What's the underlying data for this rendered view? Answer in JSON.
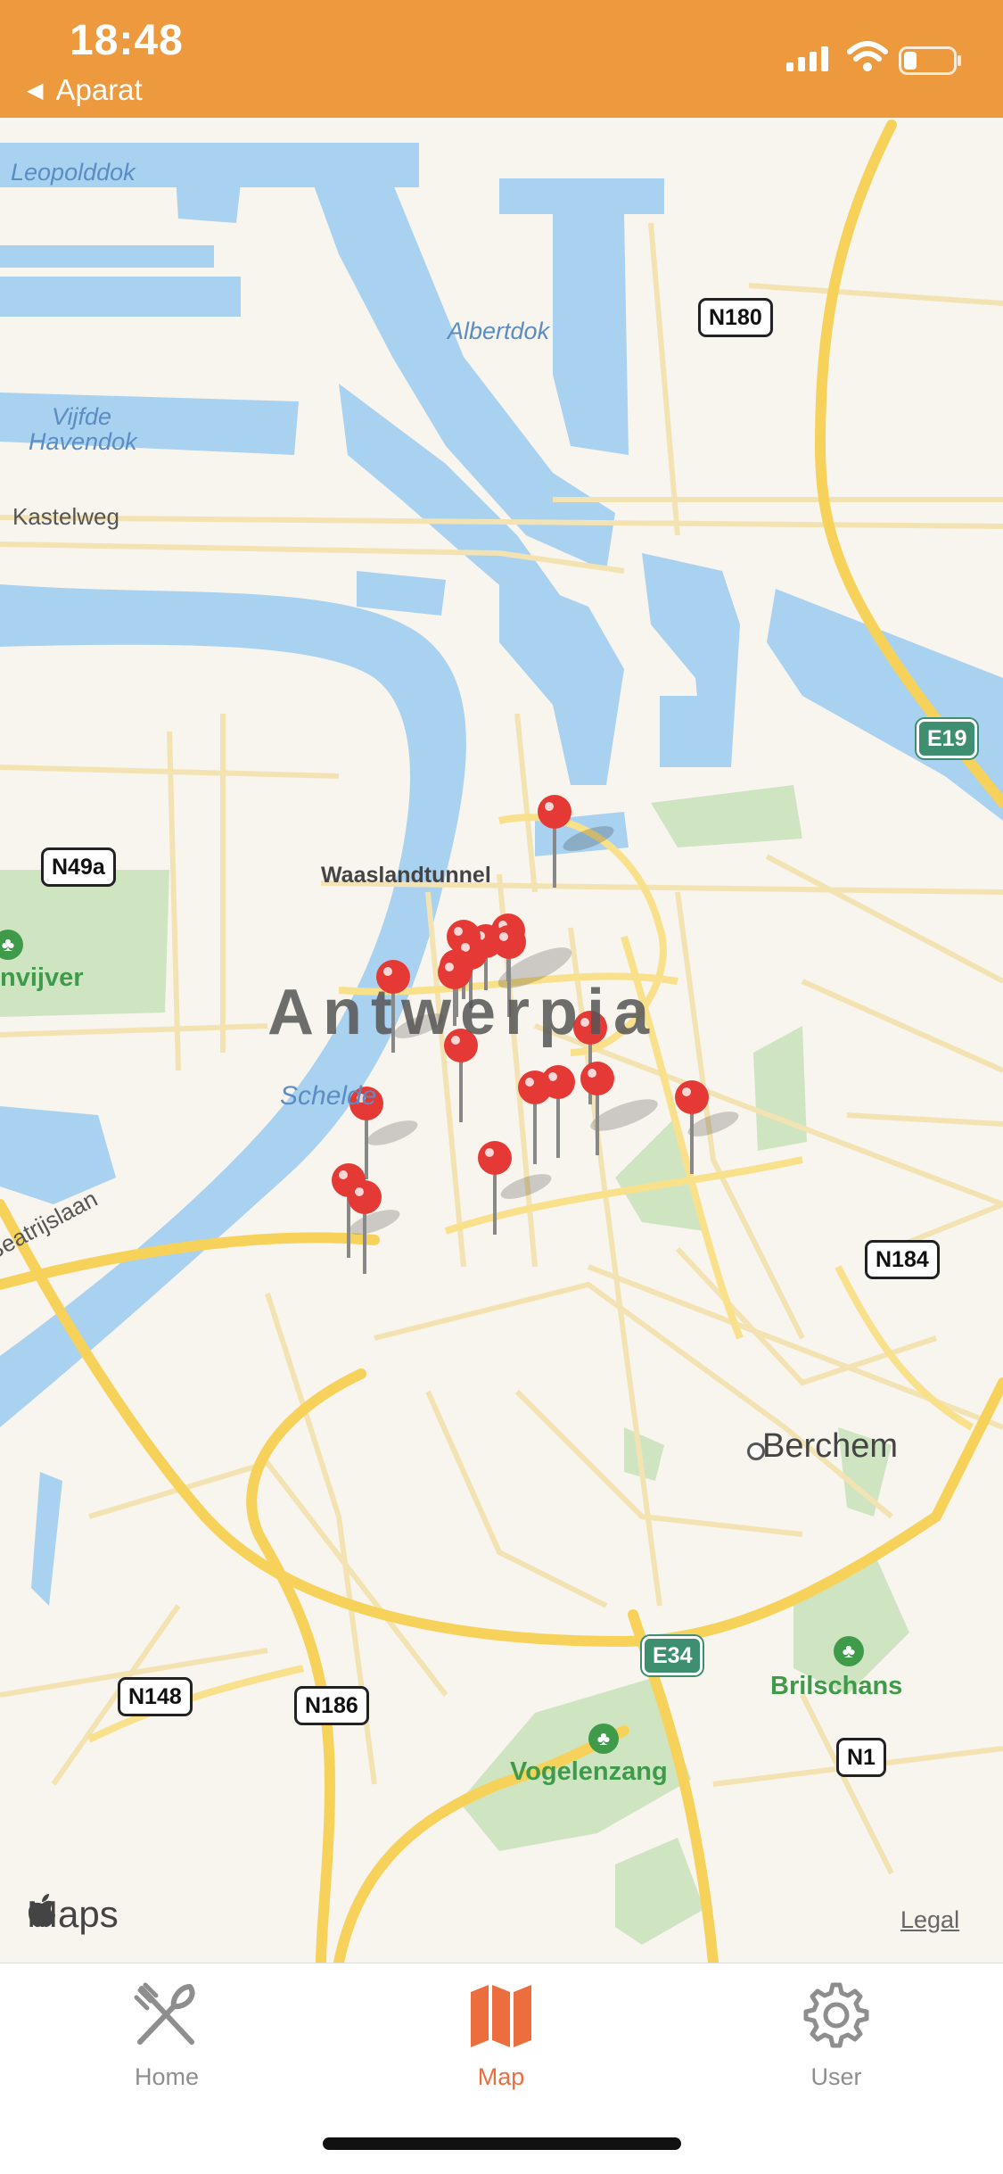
{
  "status_bar": {
    "time": "18:48",
    "back_label": "Aparat"
  },
  "map": {
    "labels": {
      "leopolddok": "Leopolddok",
      "albertdok": "Albertdok",
      "vijfde": "Vijfde",
      "havendok": "Havendok",
      "kastelweg": "Kastelweg",
      "waaslandtunnel": "Waaslandtunnel",
      "city": "Antwerpia",
      "schelde": "Schelde",
      "beatrijslaan": "Beatrijslaan",
      "vijver": "nvijver",
      "berchem": "Berchem",
      "brilschans": "Brilschans",
      "vogelenzang": "Vogelenzang"
    },
    "road_shields": {
      "n180": "N180",
      "e19": "E19",
      "n49a": "N49a",
      "n184": "N184",
      "e34": "E34",
      "n148": "N148",
      "n186": "N186",
      "n1": "N1"
    },
    "pin_count": 19,
    "attribution": {
      "logo": "Maps",
      "legal": "Legal"
    }
  },
  "tab_bar": {
    "home": "Home",
    "map": "Map",
    "user": "User",
    "active": "Map",
    "active_color": "#ec6e3f",
    "inactive_color": "#8e8e8e"
  },
  "colors": {
    "accent": "#ed9a3e",
    "water": "#a9d1f0",
    "road_major": "#f7d25b",
    "park": "#cfe5c2",
    "pin": "#e53935"
  }
}
